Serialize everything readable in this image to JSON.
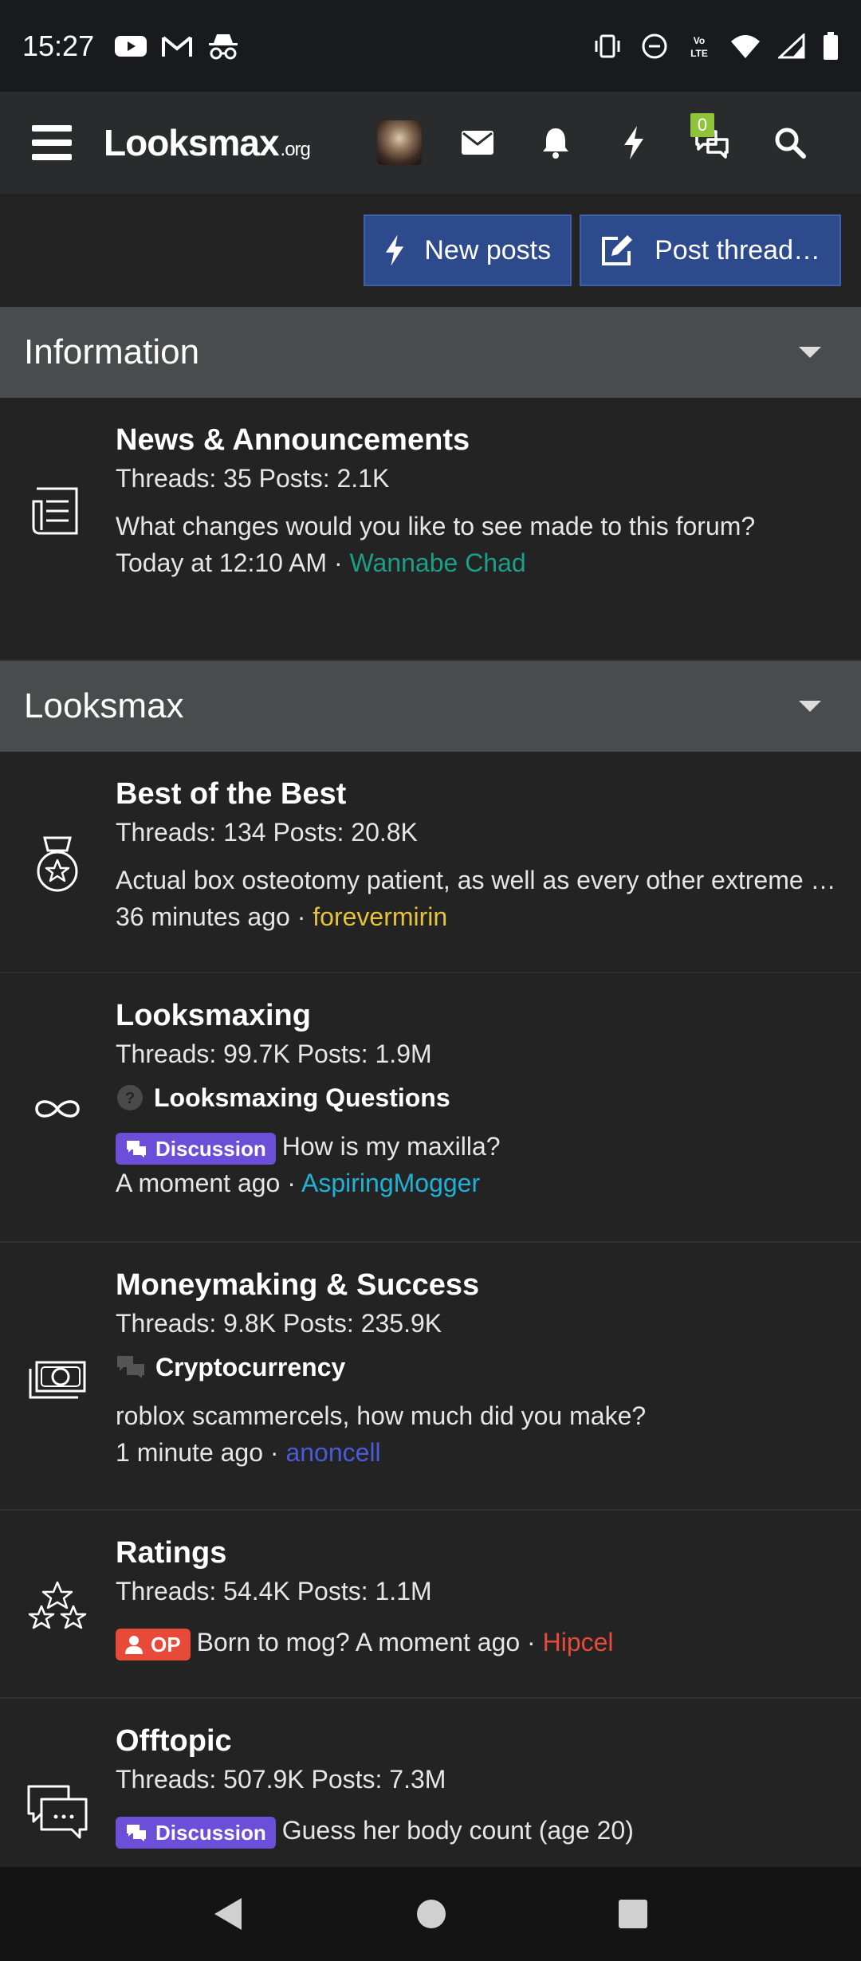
{
  "status": {
    "time": "15:27"
  },
  "header": {
    "logo_main": "Looksmax",
    "logo_suffix": ".org",
    "badge_count": "0"
  },
  "actions": {
    "new_posts": "New posts",
    "post_thread": "Post thread…"
  },
  "categories": [
    {
      "title": "Information",
      "forums": [
        {
          "title": "News & Announcements",
          "stats": "Threads: 35 Posts: 2.1K",
          "last": "What changes would you like to see made to this forum?",
          "time": "Today at 12:10 AM",
          "user": "Wannabe Chad",
          "user_color": "#1aa08a"
        }
      ]
    },
    {
      "title": "Looksmax",
      "forums": [
        {
          "title": "Best of the Best",
          "stats": "Threads: 134 Posts: 20.8K",
          "last": "Actual box osteotomy patient, as well as every other extreme …",
          "time": "36 minutes ago",
          "user": "forevermirin",
          "user_color": "#e6c33a"
        },
        {
          "title": "Looksmaxing",
          "stats": "Threads: 99.7K Posts: 1.9M",
          "subforum": "Looksmaxing Questions",
          "prefix": "Discussion",
          "last": "How is my maxilla?",
          "time": "A moment ago",
          "user": "AspiringMogger",
          "user_color": "#1fb2d6"
        },
        {
          "title": "Moneymaking & Success",
          "stats": "Threads: 9.8K Posts: 235.9K",
          "subforum": "Cryptocurrency",
          "last": "roblox scammercels, how much did you make?",
          "time": "1 minute ago",
          "user": "anoncell",
          "user_color": "#4a5bd8"
        },
        {
          "title": "Ratings",
          "stats": "Threads: 54.4K Posts: 1.1M",
          "prefix": "OP",
          "last": "Born to mog?",
          "time": "A moment ago",
          "user": "Hipcel",
          "user_color": "#e84a3a"
        },
        {
          "title": "Offtopic",
          "stats": "Threads: 507.9K Posts: 7.3M",
          "prefix": "Discussion",
          "last": "Guess her body count (age 20)"
        }
      ]
    }
  ],
  "separator": "·"
}
